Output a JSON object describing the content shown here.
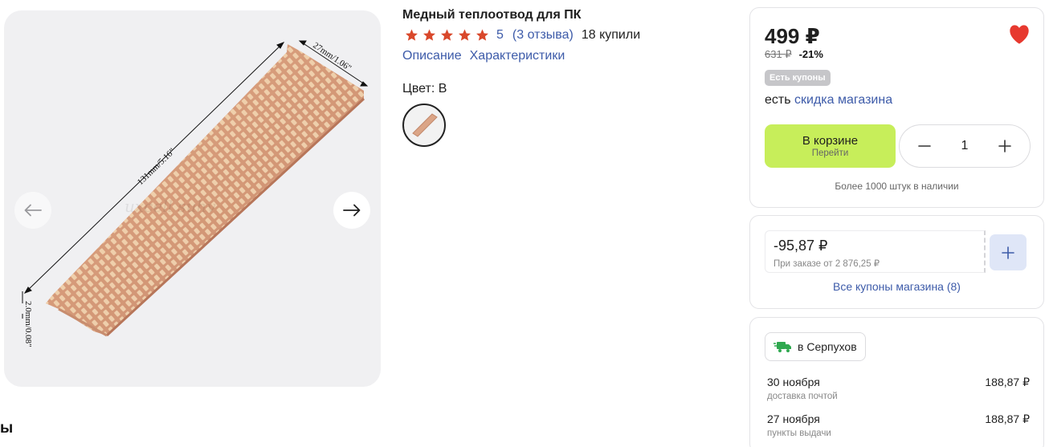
{
  "product": {
    "title": "Медный теплоотвод для ПК",
    "rating": "5",
    "reviews": "(3 отзыва)",
    "bought": "18 купили",
    "rating_stars": 5,
    "links": [
      "Описание",
      "Характеристики"
    ],
    "color_label": "Цвет: B"
  },
  "gallery": {
    "dim_length": "131mm/5.16\"",
    "dim_width": "27mm/1.06\"",
    "dim_height": "2.0mm/0.08\"",
    "watermark": "uxcell suhv",
    "prev_icon": "arrow-left-icon",
    "next_icon": "arrow-right-icon"
  },
  "section_peek": "ы",
  "price_card": {
    "price": "499 ₽",
    "old_price": "631 ₽",
    "discount": "-21%",
    "coupon_badge": "Есть купоны",
    "store_discount_prefix": "есть",
    "store_discount_link": "скидка магазина",
    "cart_label": "В корзине",
    "cart_sub": "Перейти",
    "quantity": "1",
    "stock": "Более 1000 штук в наличии"
  },
  "coupon_card": {
    "amount": "-95,87 ₽",
    "condition": "При заказе от 2 876,25 ₽",
    "all_coupons": "Все купоны магазина (8)"
  },
  "delivery_card": {
    "city": "в Серпухов",
    "options": [
      {
        "date": "30 ноября",
        "type": "доставка почтой",
        "price": "188,87 ₽"
      },
      {
        "date": "27 ноября",
        "type": "пункты выдачи",
        "price": "188,87 ₽"
      }
    ]
  },
  "colors": {
    "accent_green": "#c7ee5a",
    "link_blue": "#3d5ba9",
    "star_red": "#d9482b",
    "heart_red": "#e7392f",
    "truck_green": "#2fa84f"
  }
}
